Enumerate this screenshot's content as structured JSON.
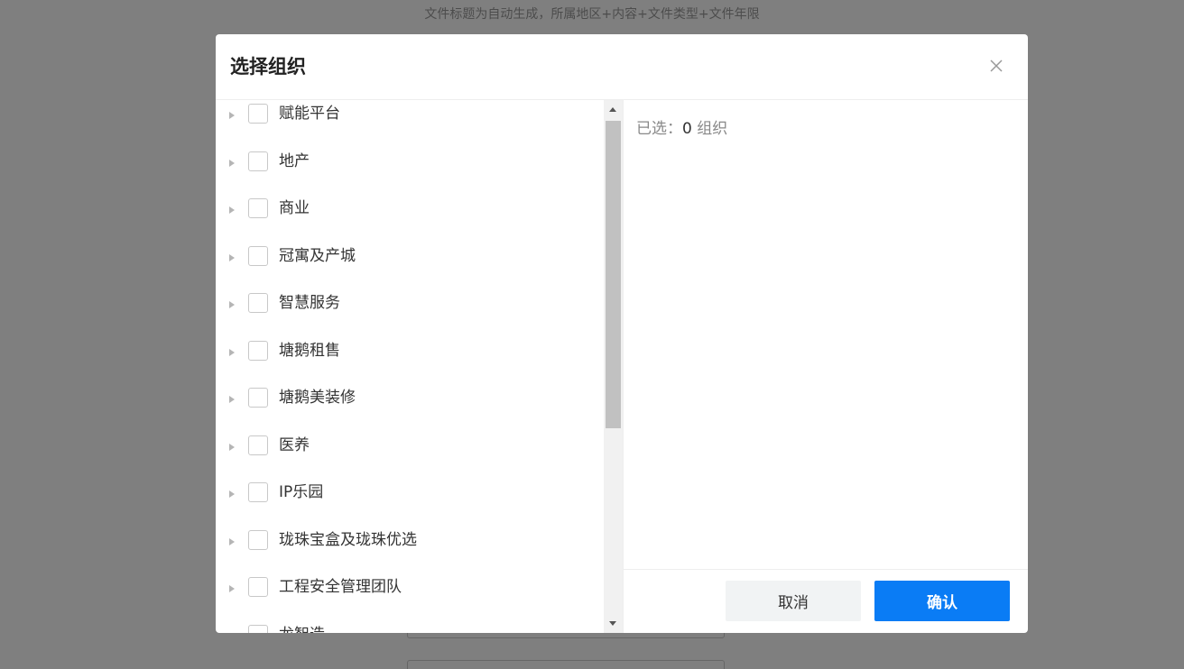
{
  "background": {
    "hint_text": "文件标题为自动生成，所属地区+内容+文件类型+文件年限"
  },
  "dialog": {
    "title": "选择组织",
    "close_icon": "close-icon",
    "tree": {
      "items": [
        {
          "label": "赋能平台"
        },
        {
          "label": "地产"
        },
        {
          "label": "商业"
        },
        {
          "label": "冠寓及产城"
        },
        {
          "label": "智慧服务"
        },
        {
          "label": "塘鹅租售"
        },
        {
          "label": "塘鹅美装修"
        },
        {
          "label": "医养"
        },
        {
          "label": "IP乐园"
        },
        {
          "label": "珑珠宝盒及珑珠优选"
        },
        {
          "label": "工程安全管理团队"
        },
        {
          "label": "龙智造"
        }
      ]
    },
    "selected": {
      "prefix": "已选：",
      "count": "0",
      "suffix": " 组织"
    },
    "buttons": {
      "cancel": "取消",
      "confirm": "确认"
    }
  },
  "colors": {
    "primary": "#0a7cf5",
    "overlay": "rgba(0,0,0,0.5)"
  }
}
